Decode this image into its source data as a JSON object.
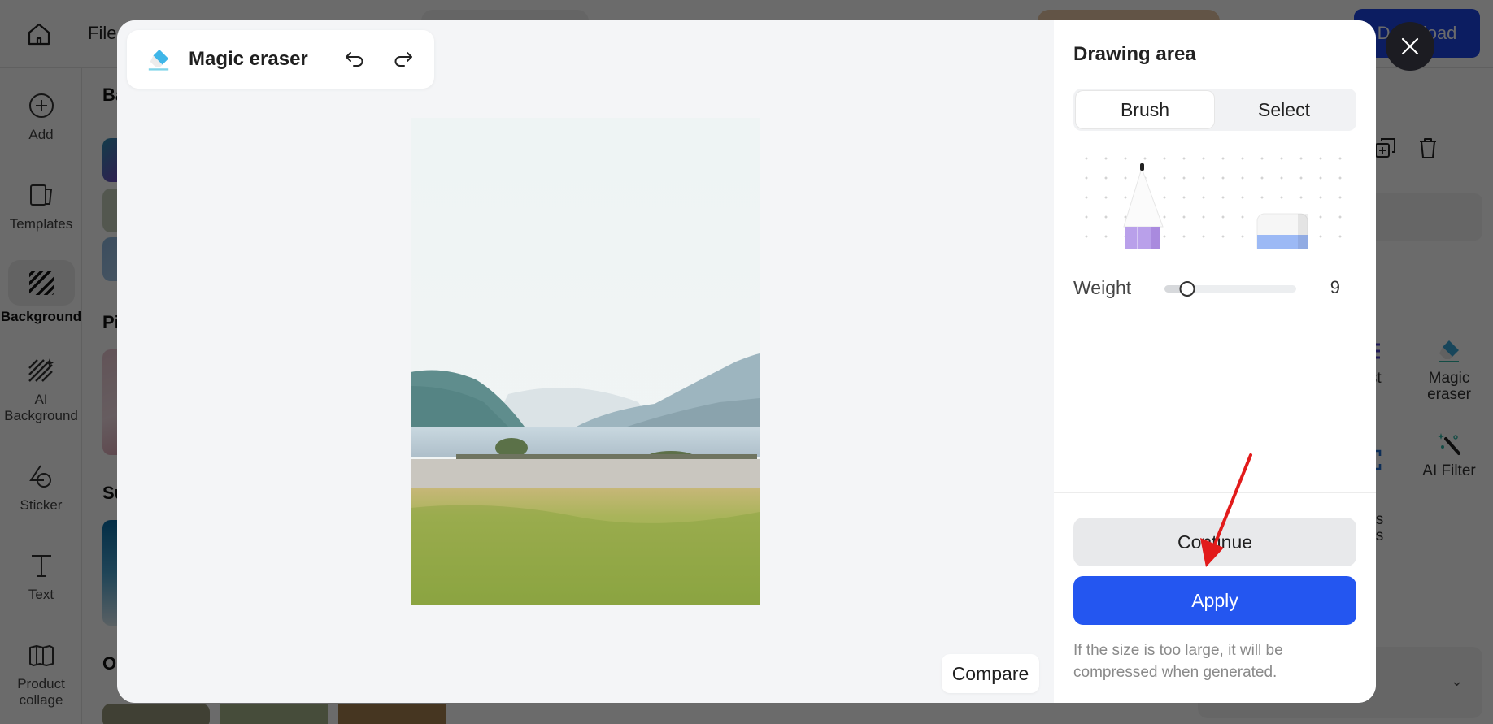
{
  "app": {
    "file_menu": "File",
    "download_label": "Download",
    "nav": [
      {
        "label": "Add",
        "icon": "plus-circle-icon"
      },
      {
        "label": "Templates",
        "icon": "templates-icon"
      },
      {
        "label": "Background",
        "icon": "background-icon",
        "active": true
      },
      {
        "label": "AI Background",
        "icon": "ai-background-icon"
      },
      {
        "label": "Sticker",
        "icon": "sticker-icon"
      },
      {
        "label": "Text",
        "icon": "text-icon"
      },
      {
        "label": "Product collage",
        "icon": "collage-icon"
      }
    ],
    "bg_panel_headings": [
      "Ba",
      "Pi",
      "Su",
      "O"
    ],
    "right_tools": [
      {
        "label": "ust",
        "icon": "adjust-icon"
      },
      {
        "label": "Magic eraser",
        "icon": "magic-eraser-icon"
      },
      {
        "label": "l\nnds\nges",
        "icon": "ai-expand-icon"
      },
      {
        "label": "AI Filter",
        "icon": "ai-filter-icon"
      }
    ]
  },
  "modal": {
    "toolbar": {
      "title": "Magic eraser",
      "undo_icon": "undo-icon",
      "redo_icon": "redo-icon"
    },
    "compare_label": "Compare",
    "side": {
      "heading": "Drawing area",
      "modes": [
        "Brush",
        "Select"
      ],
      "active_mode": "Brush",
      "weight_label": "Weight",
      "weight_value": "9",
      "weight_fraction": 0.17,
      "continue_label": "Continue",
      "apply_label": "Apply",
      "hint": "If the size is too large, it will be compressed when generated."
    },
    "close_icon": "close-icon"
  },
  "colors": {
    "accent": "#2456f0",
    "annotation_arrow": "#e21b1b"
  }
}
